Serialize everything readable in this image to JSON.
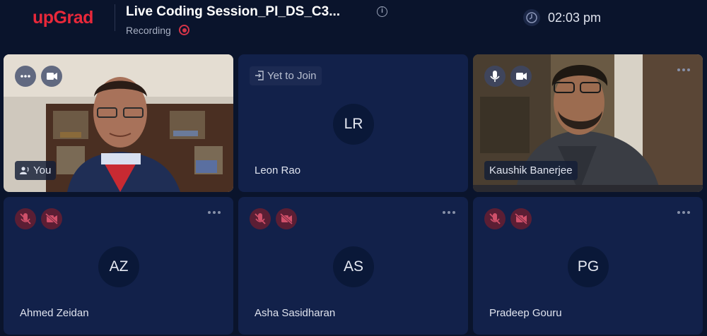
{
  "header": {
    "logo": "upGrad",
    "session_title": "Live Coding Session_PI_DS_C3...",
    "recording_label": "Recording",
    "time": "02:03 pm"
  },
  "participants": [
    {
      "name": "You",
      "type": "video"
    },
    {
      "name": "Leon Rao",
      "initials": "LR",
      "status": "Yet to Join"
    },
    {
      "name": "Kaushik Banerjee",
      "type": "video"
    },
    {
      "name": "Ahmed Zeidan",
      "initials": "AZ",
      "mic": "muted",
      "camera": "off"
    },
    {
      "name": "Asha Sasidharan",
      "initials": "AS",
      "mic": "muted",
      "camera": "off"
    },
    {
      "name": "Pradeep Gouru",
      "initials": "PG",
      "mic": "muted",
      "camera": "off"
    }
  ],
  "icons": {
    "brand_color": "#e8283a",
    "recording_color": "#d23448",
    "muted_color": "#5b1e34"
  }
}
